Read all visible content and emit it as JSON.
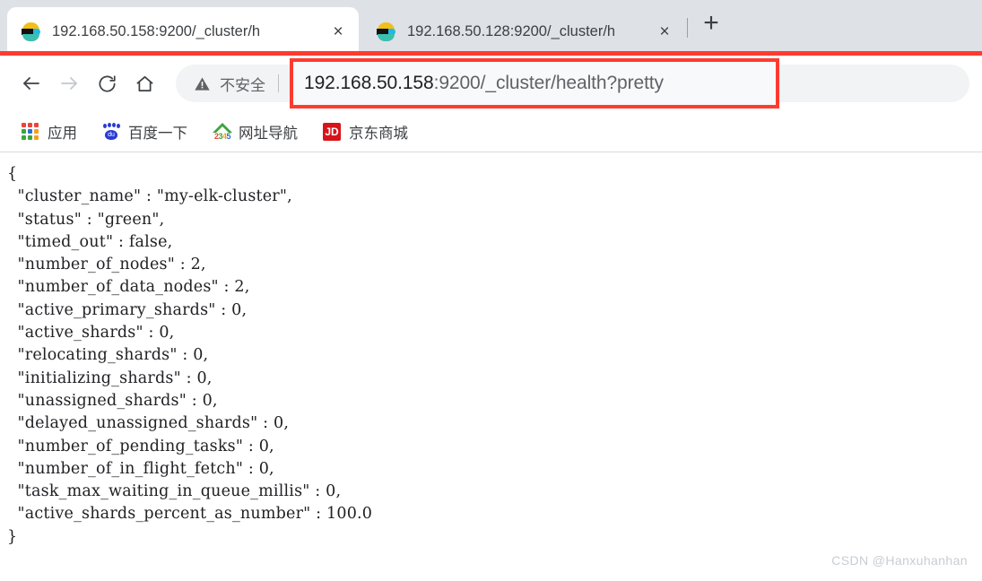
{
  "browser": {
    "tabs": [
      {
        "title": "192.168.50.158:9200/_cluster/h",
        "favicon": "elasticsearch-icon",
        "active": true,
        "close_label": "×"
      },
      {
        "title": "192.168.50.128:9200/_cluster/h",
        "favicon": "elasticsearch-icon",
        "active": false,
        "close_label": "×"
      }
    ],
    "new_tab_label": "+",
    "toolbar": {
      "back_icon": "arrow-left-icon",
      "forward_icon": "arrow-right-icon",
      "reload_icon": "reload-icon",
      "home_icon": "home-icon",
      "security_label": "不安全",
      "security_icon": "warning-triangle-icon",
      "url_host": "192.168.50.158",
      "url_path": ":9200/_cluster/health?pretty",
      "url_full": "192.168.50.158:9200/_cluster/health?pretty",
      "highlight_color": "#ff3b30"
    },
    "bookmarks": [
      {
        "label": "应用",
        "icon": "apps-grid-icon"
      },
      {
        "label": "百度一下",
        "icon": "baidu-paw-icon"
      },
      {
        "label": "网址导航",
        "icon": "nav2345-house-icon"
      },
      {
        "label": "京东商城",
        "icon": "jd-icon"
      }
    ]
  },
  "content": {
    "response_text": "{\n  \"cluster_name\" : \"my-elk-cluster\",\n  \"status\" : \"green\",\n  \"timed_out\" : false,\n  \"number_of_nodes\" : 2,\n  \"number_of_data_nodes\" : 2,\n  \"active_primary_shards\" : 0,\n  \"active_shards\" : 0,\n  \"relocating_shards\" : 0,\n  \"initializing_shards\" : 0,\n  \"unassigned_shards\" : 0,\n  \"delayed_unassigned_shards\" : 0,\n  \"number_of_pending_tasks\" : 0,\n  \"number_of_in_flight_fetch\" : 0,\n  \"task_max_waiting_in_queue_millis\" : 0,\n  \"active_shards_percent_as_number\" : 100.0\n}",
    "fields": {
      "cluster_name": "my-elk-cluster",
      "status": "green",
      "timed_out": "false",
      "number_of_nodes": "2",
      "number_of_data_nodes": "2",
      "active_primary_shards": "0",
      "active_shards": "0",
      "relocating_shards": "0",
      "initializing_shards": "0",
      "unassigned_shards": "0",
      "delayed_unassigned_shards": "0",
      "number_of_pending_tasks": "0",
      "number_of_in_flight_fetch": "0",
      "task_max_waiting_in_queue_millis": "0",
      "active_shards_percent_as_number": "100.0"
    },
    "watermark": "CSDN @Hanxuhanhan"
  },
  "apps_grid_colors": [
    "#e8453c",
    "#e8453c",
    "#e8453c",
    "#3aa63a",
    "#2a6fd6",
    "#f0a020",
    "#3aa63a",
    "#3aa63a",
    "#f0a020"
  ],
  "nav2345_digits": [
    "2",
    "3",
    "4",
    "5"
  ],
  "jd_text": "JD",
  "baidu_text": "du"
}
